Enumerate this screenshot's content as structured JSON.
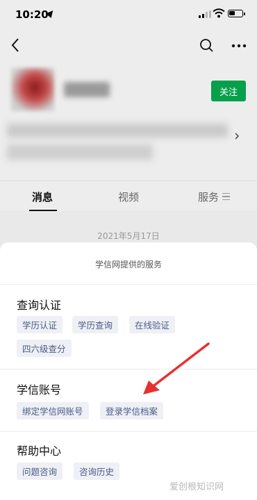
{
  "status_bar": {
    "time": "10:20"
  },
  "profile": {
    "follow_label": "关注"
  },
  "tabs": [
    {
      "label": "消息"
    },
    {
      "label": "视频"
    },
    {
      "label": "服务"
    }
  ],
  "feed": {
    "date": "2021年5月17日"
  },
  "sheet": {
    "title": "学信网提供的服务",
    "sections": [
      {
        "title": "查询认证",
        "items": [
          "学历认证",
          "学历查询",
          "在线验证",
          "四六级查分"
        ]
      },
      {
        "title": "学信账号",
        "items": [
          "绑定学信网账号",
          "登录学信档案"
        ]
      },
      {
        "title": "帮助中心",
        "items": [
          "问题咨询",
          "咨询历史"
        ]
      }
    ]
  },
  "annotation": {
    "arrow_color": "#e8302f"
  },
  "watermark": {
    "text": "爱创根知识网"
  },
  "colors": {
    "follow": "#07a04a",
    "chip_bg": "#eef0f5",
    "chip_text": "#4a5c86"
  }
}
